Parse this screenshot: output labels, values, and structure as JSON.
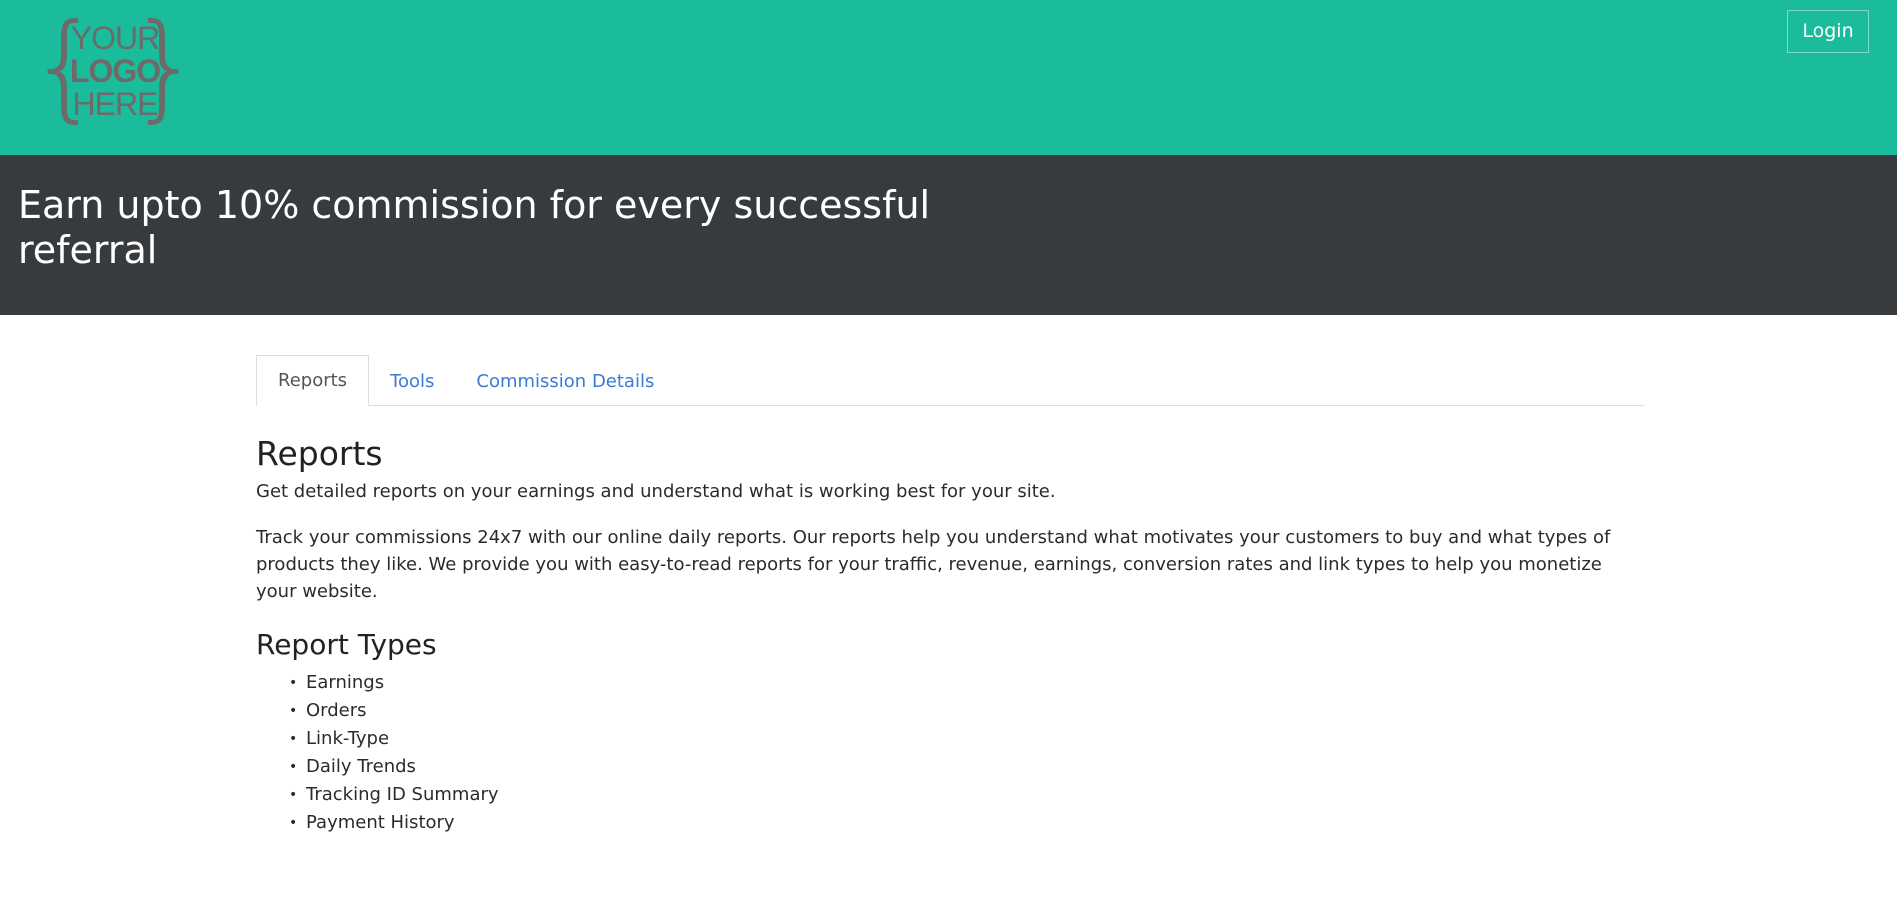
{
  "header": {
    "logo": {
      "line1": "YOUR",
      "line2": "LOGO",
      "line3": "HERE"
    },
    "login_label": "Login",
    "background_color": "#1abc9c"
  },
  "hero": {
    "title": "Earn upto 10% commission for every successful referral",
    "background_color": "#383b3e"
  },
  "tabs": [
    {
      "label": "Reports",
      "active": true
    },
    {
      "label": "Tools",
      "active": false
    },
    {
      "label": "Commission Details",
      "active": false
    }
  ],
  "reports": {
    "title": "Reports",
    "lead": "Get detailed reports on your earnings and understand what is working best for your site.",
    "body": "Track your commissions 24x7 with our online daily reports. Our reports help you understand what motivates your customers to buy and what types of products they like. We provide you with easy-to-read reports for your traffic, revenue, earnings, conversion rates and link types to help you monetize your website.",
    "types_title": "Report Types",
    "types": [
      "Earnings",
      "Orders",
      "Link-Type",
      "Daily Trends",
      "Tracking ID Summary",
      "Payment History"
    ]
  }
}
